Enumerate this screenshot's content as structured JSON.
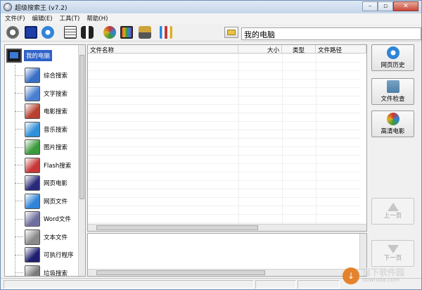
{
  "window": {
    "title": "超级搜索王 (v7.2)"
  },
  "menu": [
    "文件(F)",
    "编辑(E)",
    "工具(T)",
    "帮助(H)"
  ],
  "toolbar": {
    "icons": [
      "support-icon",
      "save-icon",
      "ie-browser-icon",
      "list-view-icon",
      "binoculars-icon",
      "film-reel-icon",
      "monitor-color-icon",
      "scanner-icon",
      "tools-icon"
    ],
    "path_value": "我的电脑"
  },
  "nav": {
    "root_label": "我的电脑",
    "items": [
      {
        "label": "综合搜索",
        "icon": "multi-window-icon",
        "color": "#3a6fc6"
      },
      {
        "label": "文字搜索",
        "icon": "text-columns-icon",
        "color": "#4a7fd0"
      },
      {
        "label": "电影搜索",
        "icon": "film-reel-icon",
        "color": "#b8402f"
      },
      {
        "label": "音乐搜索",
        "icon": "music-icon",
        "color": "#2f8fd8"
      },
      {
        "label": "图片搜索",
        "icon": "picture-icon",
        "color": "#3b9a3b"
      },
      {
        "label": "Flash搜索",
        "icon": "flash-icon",
        "color": "#c83737"
      },
      {
        "label": "网页电影",
        "icon": "web-movie-icon",
        "color": "#2a2a7a"
      },
      {
        "label": "网页文件",
        "icon": "ie-page-icon",
        "color": "#2f84d8"
      },
      {
        "label": "Word文件",
        "icon": "word-doc-icon",
        "color": "#6f6f9f"
      },
      {
        "label": "文本文件",
        "icon": "text-file-icon",
        "color": "#8a8a8a"
      },
      {
        "label": "可执行程序",
        "icon": "exe-console-icon",
        "color": "#1f1f6f"
      },
      {
        "label": "垃圾搜索",
        "icon": "trash-icon",
        "color": "#7a7a7a"
      }
    ]
  },
  "filelist": {
    "columns": [
      "文件名称",
      "大小",
      "类型",
      "文件路径"
    ]
  },
  "side_buttons": [
    {
      "label": "网页历史",
      "icon": "ie-history-icon",
      "color": "#2f84d8",
      "enabled": true
    },
    {
      "label": "文件检查",
      "icon": "folder-check-icon",
      "color": "#4d7fa6",
      "enabled": true
    },
    {
      "label": "高清电影",
      "icon": "hd-film-icon",
      "color": "#b8402f",
      "enabled": true
    },
    {
      "label": "上一页",
      "icon": "arrow-up-icon",
      "enabled": false
    },
    {
      "label": "下一页",
      "icon": "arrow-down-icon",
      "enabled": false
    }
  ],
  "watermark": {
    "main": "当下软件园",
    "sub": "downxia.com"
  }
}
